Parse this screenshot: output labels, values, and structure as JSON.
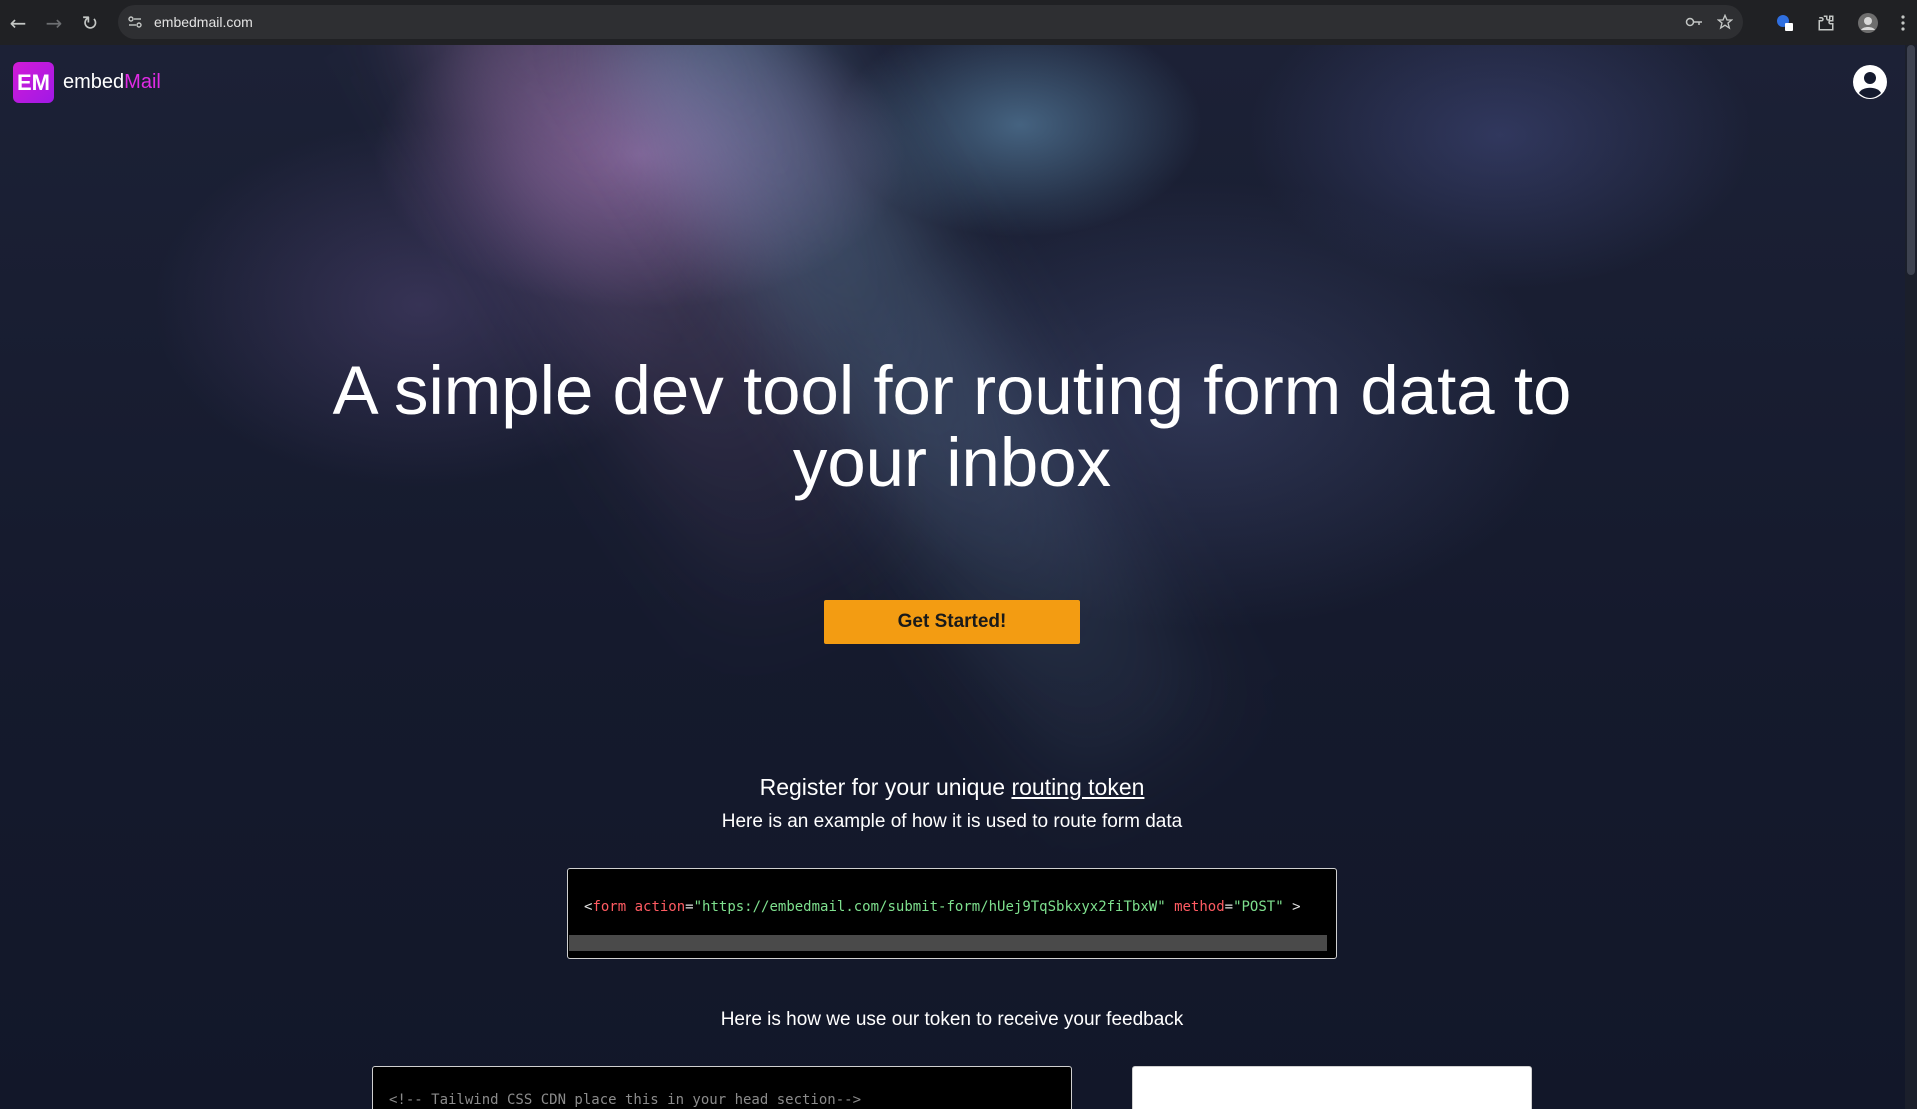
{
  "browser": {
    "url": "embedmail.com",
    "back_label": "←",
    "forward_label": "→",
    "reload_label": "↻"
  },
  "header": {
    "logo_badge": "EM",
    "logo_text_main": "embed",
    "logo_text_accent": "Mail"
  },
  "hero": {
    "title": "A simple dev tool for routing form data to your inbox",
    "cta_label": "Get Started!"
  },
  "register": {
    "prefix": "Register for your unique ",
    "link_text": "routing token",
    "subtitle": "Here is an example of how it is used to route form data"
  },
  "code_example": {
    "open_bracket": "<",
    "tag": "form",
    "attr_action": "action",
    "eq1": "=",
    "action_value": "\"https://embedmail.com/submit-form/hUej9TqSbkxyx2fiTbxW\"",
    "attr_method": "method",
    "eq2": "=",
    "method_value": "\"POST\"",
    "close_bracket": ">"
  },
  "feedback": {
    "note": "Here is how we use our token to receive your feedback",
    "code_comment": "<!-- Tailwind CSS CDN place this in your head section-->"
  },
  "colors": {
    "accent": "#e12be5",
    "cta": "#f39c12",
    "background": "#141a2e"
  }
}
